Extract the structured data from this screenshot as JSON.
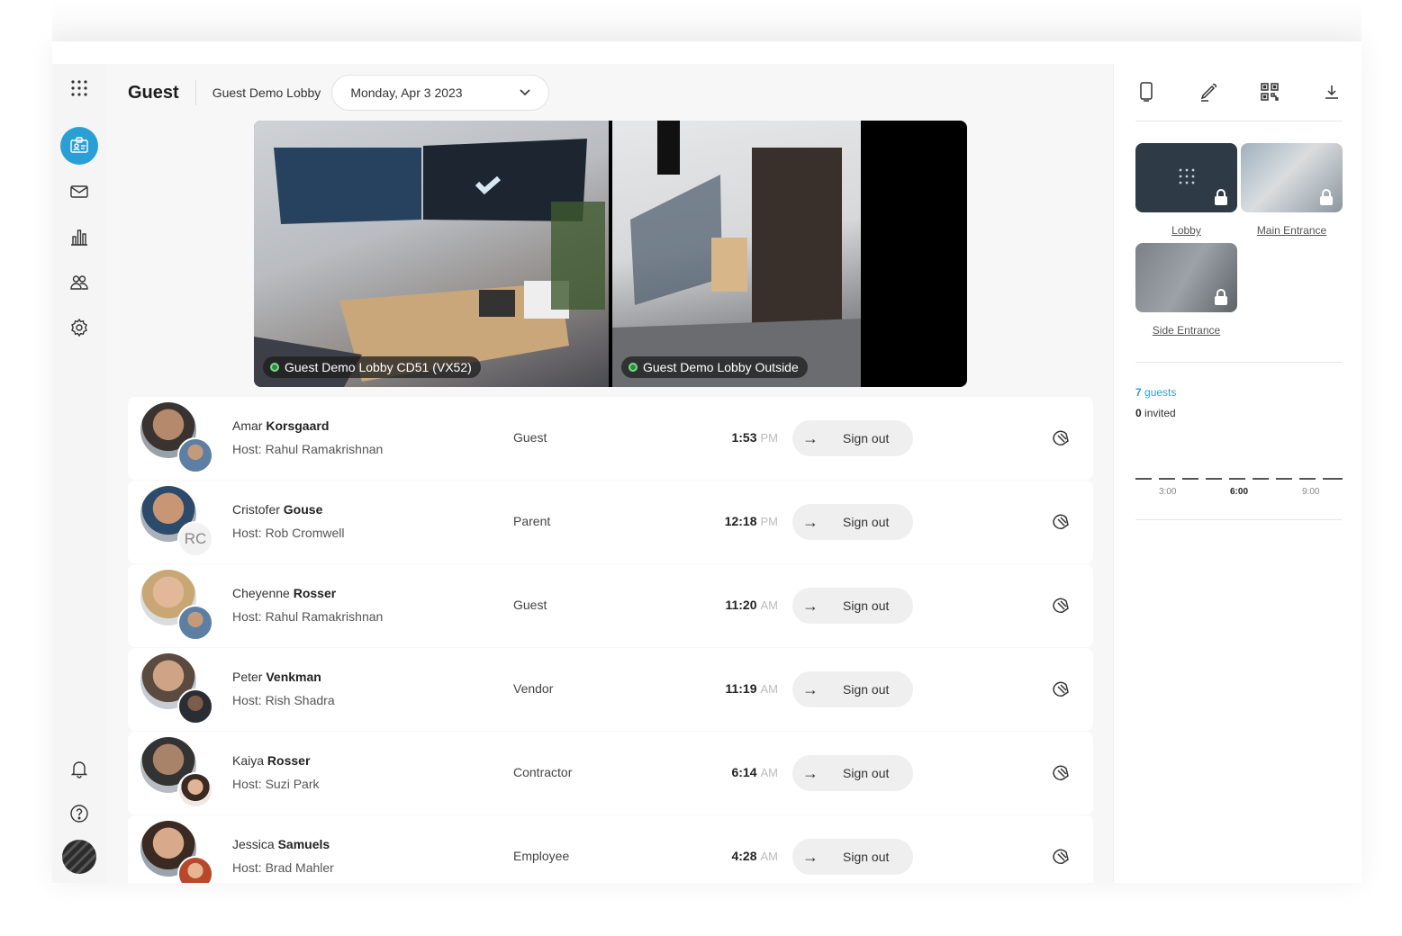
{
  "header": {
    "title": "Guest",
    "lobby": "Guest Demo Lobby",
    "date": "Monday, Apr 3 2023"
  },
  "cameras": [
    {
      "label": "Guest Demo Lobby CD51 (VX52)"
    },
    {
      "label": "Guest Demo Lobby Outside"
    }
  ],
  "visitors": [
    {
      "first": "Amar",
      "last": "Korsgaard",
      "host": "Host: Rahul Ramakrishnan",
      "type": "Guest",
      "time": "1:53",
      "ampm": "PM",
      "action": "Sign out",
      "host_initials": ""
    },
    {
      "first": "Cristofer",
      "last": "Gouse",
      "host": "Host: Rob Cromwell",
      "type": "Parent",
      "time": "12:18",
      "ampm": "PM",
      "action": "Sign out",
      "host_initials": "RC"
    },
    {
      "first": "Cheyenne",
      "last": "Rosser",
      "host": "Host: Rahul Ramakrishnan",
      "type": "Guest",
      "time": "11:20",
      "ampm": "AM",
      "action": "Sign out",
      "host_initials": ""
    },
    {
      "first": "Peter",
      "last": "Venkman",
      "host": "Host: Rish Shadra",
      "type": "Vendor",
      "time": "11:19",
      "ampm": "AM",
      "action": "Sign out",
      "host_initials": ""
    },
    {
      "first": "Kaiya",
      "last": "Rosser",
      "host": "Host: Suzi Park",
      "type": "Contractor",
      "time": "6:14",
      "ampm": "AM",
      "action": "Sign out",
      "host_initials": ""
    },
    {
      "first": "Jessica",
      "last": "Samuels",
      "host": "Host: Brad Mahler",
      "type": "Employee",
      "time": "4:28",
      "ampm": "AM",
      "action": "Sign out",
      "host_initials": ""
    }
  ],
  "doors": [
    {
      "label": "Lobby"
    },
    {
      "label": "Main Entrance"
    },
    {
      "label": "Side Entrance"
    }
  ],
  "stats": {
    "guests_count": "7",
    "guests_label": "guests",
    "invited_count": "0",
    "invited_label": "invited"
  },
  "timeline": {
    "ticks": [
      "3:00",
      "6:00",
      "9:00"
    ]
  },
  "colors": {
    "accent": "#2a9fd6"
  }
}
